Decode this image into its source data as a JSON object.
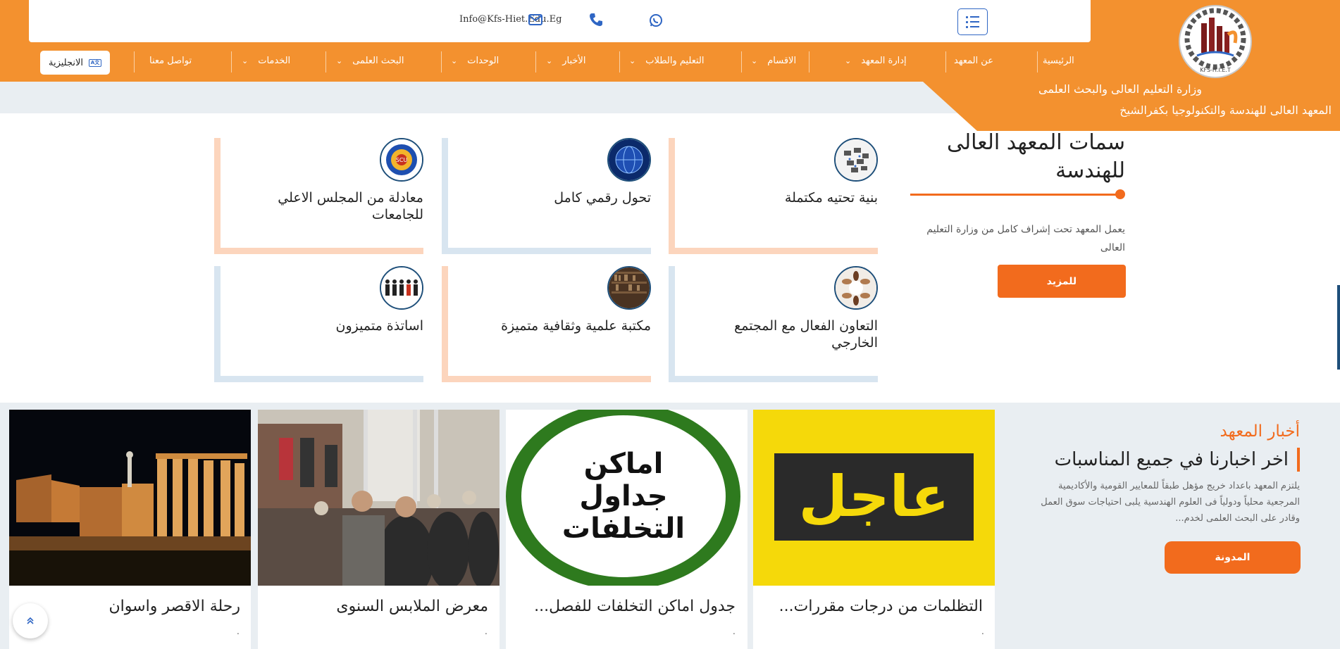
{
  "header": {
    "email": "Info@Kfs-Hiet.Edu.Eg",
    "ministry": "وزارة التعليم العالى والبحث العلمى",
    "institute": "المعهد العالى للهندسة والتكنولوجيا بكفرالشيخ",
    "logo_text": "KFS-H.I.E.T",
    "lang_button": "الانجليزية"
  },
  "nav": {
    "items": [
      {
        "label": "الرئيسية",
        "dropdown": false
      },
      {
        "label": "عن المعهد",
        "dropdown": false
      },
      {
        "label": "إدارة المعهد",
        "dropdown": true
      },
      {
        "label": "الاقسام",
        "dropdown": true
      },
      {
        "label": "التعليم والطلاب",
        "dropdown": true
      },
      {
        "label": "الأخبار",
        "dropdown": true
      },
      {
        "label": "الوحدات",
        "dropdown": true
      },
      {
        "label": "البحث العلمى",
        "dropdown": true
      },
      {
        "label": "الخدمات",
        "dropdown": true
      },
      {
        "label": "تواصل معنا",
        "dropdown": false
      }
    ],
    "chevron": "⌄"
  },
  "features": {
    "title": "سمات المعهد العالى للهندسة",
    "description": "يعمل المعهد تحت إشراف كامل من وزارة التعليم العالى",
    "more_button": "للمزيد",
    "cards": [
      {
        "label": "بنية تحتيه مكتملة",
        "icon": "servers-icon"
      },
      {
        "label": "تحول رقمي كامل",
        "icon": "digital-globe-icon"
      },
      {
        "label": "معادلة من المجلس الاعلي للجامعات",
        "icon": "council-seal-icon"
      },
      {
        "label": "التعاون الفعال مع المجتمع الخارجي",
        "icon": "handshake-icon"
      },
      {
        "label": "مكتبة علمية وثقافية متميزة",
        "icon": "library-icon"
      },
      {
        "label": "اساتذة متميزون",
        "icon": "people-icon"
      }
    ]
  },
  "news": {
    "kicker": "أخبار المعهد",
    "heading": "اخر اخبارنا في جميع المناسبات",
    "description": "يلتزم المعهد باعداد خريج مؤهل طبقاً للمعايير القومية والأكاديمية المرجعية محلياً ودولياً فى العلوم الهندسية يلبى احتياجات سوق العمل وقادر على البحث العلمى لخدم...",
    "blog_button": "المدونة",
    "items": [
      {
        "title": "التظلمات من درجات مقررات...",
        "image_text": "عاجل",
        "dot": "."
      },
      {
        "title": "جدول اماكن التخلفات للفصل...",
        "image_text": "اماكن جداول التخلفات",
        "image_lines": [
          "اماكن",
          "جداول",
          "التخلفات"
        ],
        "dot": "."
      },
      {
        "title": "معرض الملابس السنوى",
        "dot": "."
      },
      {
        "title": "رحلة الاقصر واسوان",
        "dot": "."
      }
    ]
  },
  "colors": {
    "orange": "#f3912f",
    "accent": "#f26b1d",
    "blue": "#2f66c4",
    "peach": "#fcd5bd",
    "light_blue": "#d8e5f0"
  }
}
